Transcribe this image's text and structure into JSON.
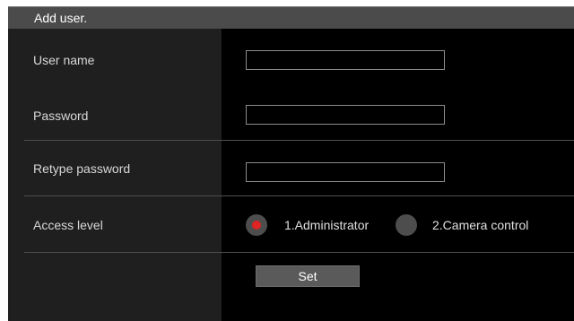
{
  "header": {
    "title": "Add user."
  },
  "form": {
    "username": {
      "label": "User name",
      "value": ""
    },
    "password": {
      "label": "Password",
      "value": ""
    },
    "retype_password": {
      "label": "Retype password",
      "value": ""
    },
    "access_level": {
      "label": "Access level",
      "options": [
        {
          "label": "1.Administrator",
          "checked": true
        },
        {
          "label": "2.Camera control",
          "checked": false
        }
      ]
    },
    "set_label": "Set"
  },
  "colors": {
    "panel_bg": "#000000",
    "header_bg": "#4b4b4b",
    "label_col_bg": "#1f1f1f",
    "radio_selected": "#e02424",
    "radio_bg": "#4d4d4d"
  }
}
